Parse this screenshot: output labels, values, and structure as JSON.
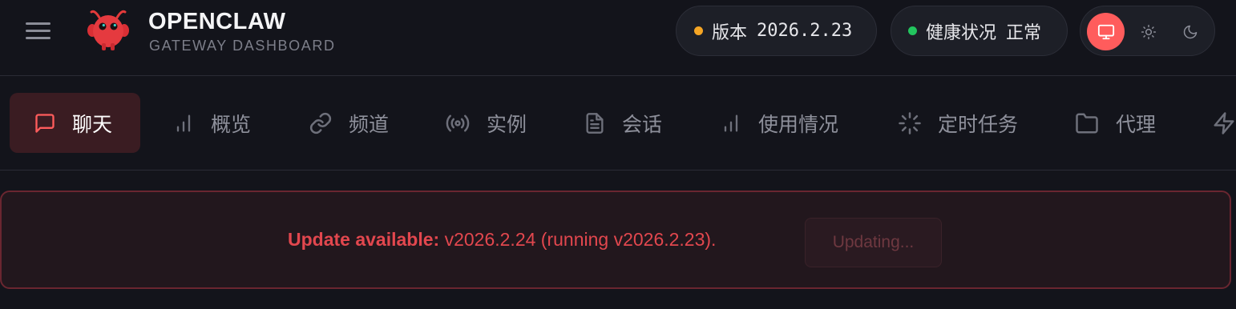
{
  "app": {
    "title": "OPENCLAW",
    "subtitle": "GATEWAY DASHBOARD",
    "logo_icon": "red-lobster-mascot-icon"
  },
  "status": {
    "version_label": "版本",
    "version_value": "2026.2.23",
    "version_dot_color": "#f5a524",
    "health_label": "健康状况",
    "health_value": "正常",
    "health_dot_color": "#22c55e"
  },
  "theme": {
    "options": [
      "system",
      "light",
      "dark"
    ],
    "selected": "system",
    "accent": "#ff5c5c"
  },
  "nav": {
    "tabs": [
      {
        "label": "聊天",
        "icon": "chat-bubble-icon",
        "active": true
      },
      {
        "label": "概览",
        "icon": "bar-chart-icon",
        "active": false
      },
      {
        "label": "频道",
        "icon": "link-icon",
        "active": false
      },
      {
        "label": "实例",
        "icon": "radio-signal-icon",
        "active": false
      },
      {
        "label": "会话",
        "icon": "document-icon",
        "active": false
      },
      {
        "label": "使用情况",
        "icon": "bar-chart-icon",
        "active": false
      },
      {
        "label": "定时任务",
        "icon": "loader-icon",
        "active": false
      },
      {
        "label": "代理",
        "icon": "folder-icon",
        "active": false
      },
      {
        "label": "",
        "icon": "lightning-icon",
        "active": false
      }
    ]
  },
  "banner": {
    "label": "Update available:",
    "message": " v2026.2.24 (running v2026.2.23).",
    "button_label": "Updating...",
    "accent": "#e2474e"
  }
}
